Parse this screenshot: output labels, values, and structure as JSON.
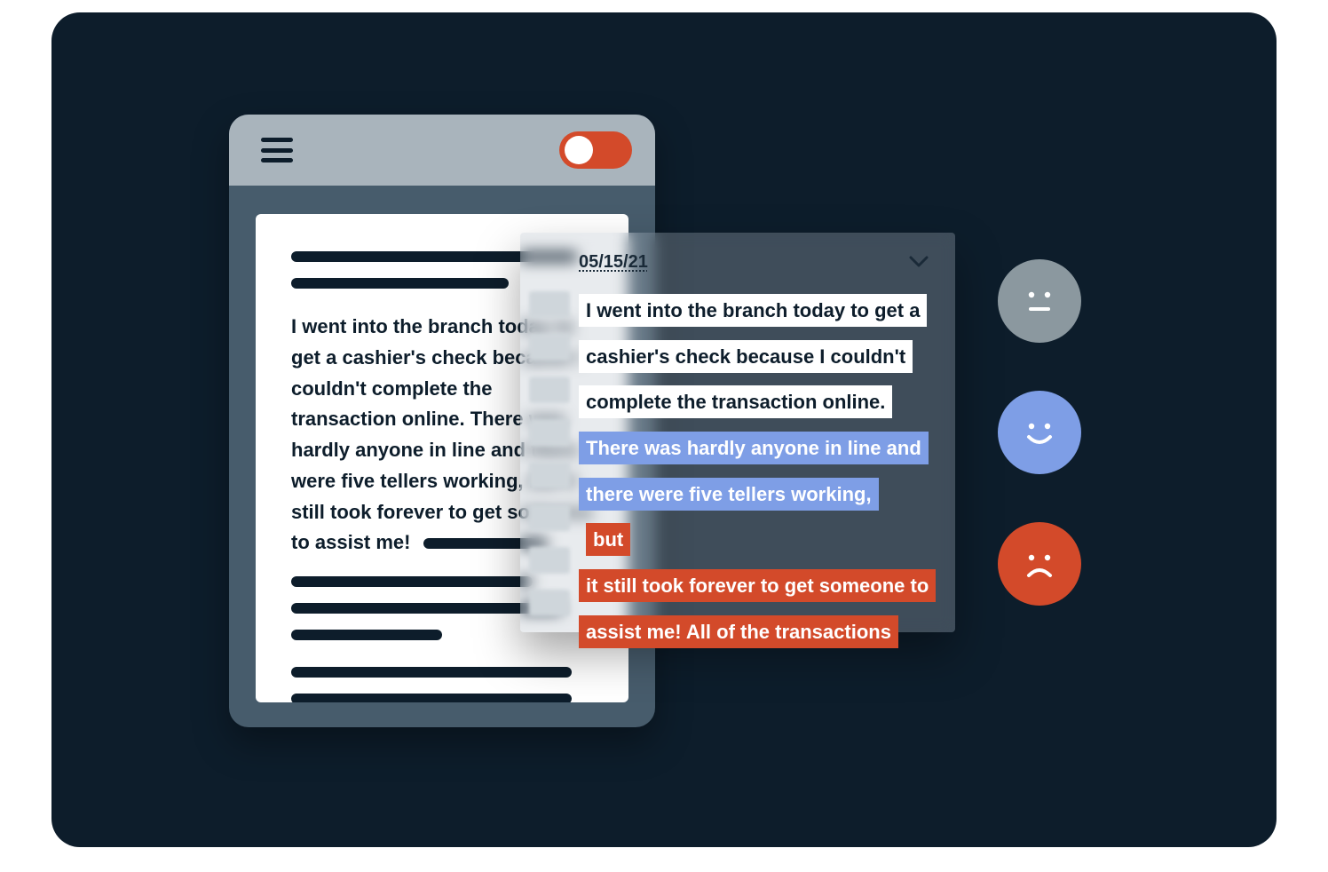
{
  "colors": {
    "background": "#0d1d2b",
    "device_body": "#475c6c",
    "device_topbar": "#a9b4bc",
    "accent_orange": "#d34a2a",
    "accent_blue": "#7e9ee6",
    "neutral_gray": "#8b989f",
    "text_dark": "#0d1d2b",
    "white": "#ffffff"
  },
  "device": {
    "icons": {
      "menu": "hamburger-icon",
      "toggle": "toggle-switch"
    },
    "toggle_on": true,
    "document": {
      "paragraph": "I went into the branch today to get a cashier's check because I couldn't complete the transaction online. There was hardly anyone in line and there were five tellers working, but it still took forever to get someone to assist me!"
    }
  },
  "analysis": {
    "date": "05/15/21",
    "expand_icon": "chevron-down-icon",
    "segments": [
      {
        "sentiment": "neutral",
        "text": "I went into the branch today to get a cashier's check because I couldn't complete the transaction online."
      },
      {
        "sentiment": "positive",
        "text": "There was hardly anyone in line and there were five tellers working,"
      },
      {
        "sentiment": "negative",
        "text": "but"
      },
      {
        "sentiment": "negative",
        "text": "it still took forever to get someone to assist me! All of the transactions"
      }
    ]
  },
  "sentiment_buttons": [
    {
      "id": "neutral",
      "icon": "face-neutral-icon"
    },
    {
      "id": "positive",
      "icon": "face-smile-icon"
    },
    {
      "id": "negative",
      "icon": "face-frown-icon"
    }
  ]
}
